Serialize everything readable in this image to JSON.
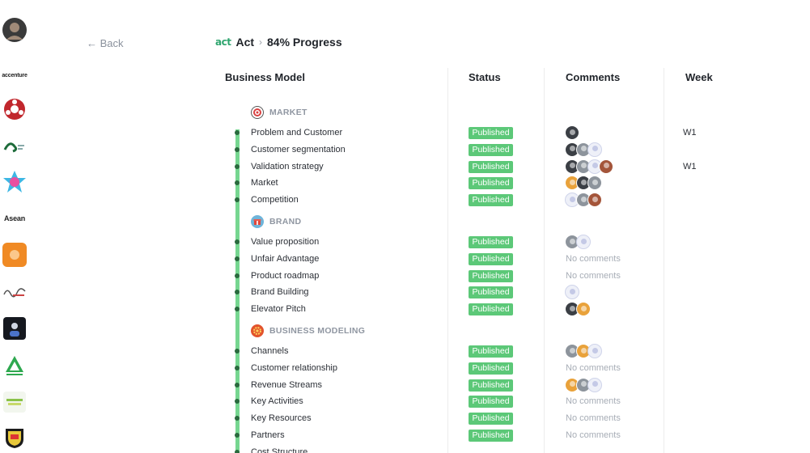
{
  "header": {
    "back_label": "← Back",
    "logo_text": "act",
    "breadcrumb_act": "Act",
    "breadcrumb_sep": "›",
    "progress_label": "84% Progress"
  },
  "sidebar": {
    "items": [
      {
        "name": "user-avatar",
        "text": ""
      },
      {
        "name": "accenture-logo",
        "text": "accenture"
      },
      {
        "name": "red-lifebuoy-logo",
        "text": ""
      },
      {
        "name": "green-org-logo",
        "text": ""
      },
      {
        "name": "star-badge-logo",
        "text": ""
      },
      {
        "name": "asean-logo",
        "text": "Asean"
      },
      {
        "name": "orange-logo",
        "text": ""
      },
      {
        "name": "script-logo",
        "text": ""
      },
      {
        "name": "dark-card-logo",
        "text": ""
      },
      {
        "name": "green-triangle-logo",
        "text": ""
      },
      {
        "name": "green-text-logo",
        "text": ""
      },
      {
        "name": "shield-logo",
        "text": ""
      }
    ]
  },
  "columns": {
    "business_model": "Business Model",
    "status": "Status",
    "comments": "Comments",
    "week": "Week"
  },
  "sections": [
    {
      "title": "MARKET",
      "icon": "target-icon",
      "rows": [
        {
          "label": "Problem and Customer",
          "status": "Published",
          "comments": [
            "dark"
          ],
          "no_comments": "",
          "week": "W1"
        },
        {
          "label": "Customer segmentation",
          "status": "Published",
          "comments": [
            "dark",
            "gray",
            "ghost"
          ],
          "no_comments": "",
          "week": ""
        },
        {
          "label": "Validation strategy",
          "status": "Published",
          "comments": [
            "dark",
            "gray",
            "ghost",
            "brown"
          ],
          "no_comments": "",
          "week": "W1"
        },
        {
          "label": "Market",
          "status": "Published",
          "comments": [
            "orange",
            "dark",
            "gray"
          ],
          "no_comments": "",
          "week": ""
        },
        {
          "label": "Competition",
          "status": "Published",
          "comments": [
            "ghost",
            "gray",
            "brown"
          ],
          "no_comments": "",
          "week": ""
        }
      ]
    },
    {
      "title": "BRAND",
      "icon": "gift-icon",
      "rows": [
        {
          "label": "Value proposition",
          "status": "Published",
          "comments": [
            "gray",
            "ghost"
          ],
          "no_comments": "",
          "week": ""
        },
        {
          "label": "Unfair Advantage",
          "status": "Published",
          "comments": [],
          "no_comments": "No comments",
          "week": ""
        },
        {
          "label": "Product roadmap",
          "status": "Published",
          "comments": [],
          "no_comments": "No comments",
          "week": ""
        },
        {
          "label": "Brand Building",
          "status": "Published",
          "comments": [
            "ghost"
          ],
          "no_comments": "",
          "week": ""
        },
        {
          "label": "Elevator Pitch",
          "status": "Published",
          "comments": [
            "dark",
            "orange"
          ],
          "no_comments": "",
          "week": ""
        }
      ]
    },
    {
      "title": "BUSINESS MODELING",
      "icon": "gear-icon",
      "rows": [
        {
          "label": "Channels",
          "status": "Published",
          "comments": [
            "gray",
            "orange",
            "ghost"
          ],
          "no_comments": "",
          "week": ""
        },
        {
          "label": "Customer relationship",
          "status": "Published",
          "comments": [],
          "no_comments": "No comments",
          "week": ""
        },
        {
          "label": "Revenue Streams",
          "status": "Published",
          "comments": [
            "orange",
            "gray",
            "ghost"
          ],
          "no_comments": "",
          "week": ""
        },
        {
          "label": "Key Activities",
          "status": "Published",
          "comments": [],
          "no_comments": "No comments",
          "week": ""
        },
        {
          "label": "Key Resources",
          "status": "Published",
          "comments": [],
          "no_comments": "No comments",
          "week": ""
        },
        {
          "label": "Partners",
          "status": "Published",
          "comments": [],
          "no_comments": "No comments",
          "week": ""
        },
        {
          "label": "Cost Structure",
          "status": "",
          "comments": [],
          "no_comments": "",
          "week": ""
        }
      ]
    }
  ],
  "colors": {
    "accent": "#5cc878",
    "timeline": "#5ecf7d",
    "muted": "#a7adb6"
  }
}
